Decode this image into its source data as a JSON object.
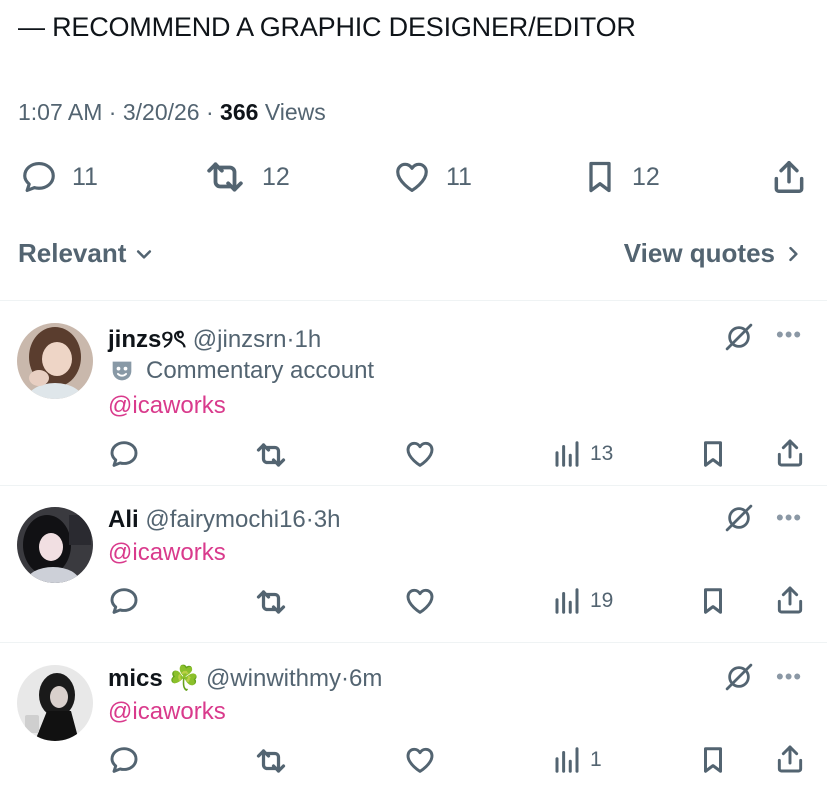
{
  "post": {
    "text": "— RECOMMEND A GRAPHIC DESIGNER/EDITOR",
    "time": "1:07 AM",
    "date": "3/20/26",
    "views_count": "366",
    "views_label": "Views",
    "sep": "·",
    "replies": "11",
    "reposts": "12",
    "likes": "11",
    "bookmarks": "12"
  },
  "filters": {
    "sort_label": "Relevant",
    "quotes_label": "View quotes"
  },
  "replies": [
    {
      "name": "jinzs୨ৎ",
      "handle": "@jinzsrn",
      "time": "1h",
      "tag": "Commentary account",
      "text": "@icaworks",
      "views": "13"
    },
    {
      "name": "Ali",
      "handle": "@fairymochi16",
      "time": "3h",
      "text": "@icaworks",
      "views": "19"
    },
    {
      "name": "mics",
      "emoji": "☘️",
      "handle": "@winwithmy",
      "time": "6m",
      "text": "@icaworks",
      "views": "1"
    }
  ],
  "icons": {
    "reply": "reply-icon",
    "repost": "repost-icon",
    "like": "heart-icon",
    "bookmark": "bookmark-icon",
    "share": "share-icon",
    "views": "views-icon",
    "grok": "grok-icon",
    "more": "more-icon"
  },
  "colors": {
    "text": "#0f1419",
    "muted": "#536471",
    "mention": "#d93a8c",
    "divider": "#eff3f4"
  }
}
